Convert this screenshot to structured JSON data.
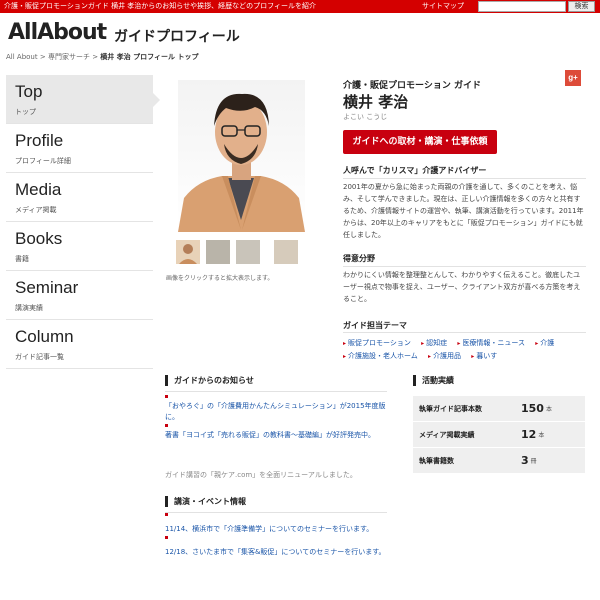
{
  "topbar": {
    "notice": "介護・販促プロモーションガイド 横井 孝治からのお知らせや挨拶、経歴などのプロフィールを紹介",
    "sitemap": "サイトマップ",
    "search_button": "検索"
  },
  "header": {
    "logo_text": "AllAbout",
    "title": "ガイドプロフィール"
  },
  "breadcrumb": {
    "items": [
      "All About",
      "専門家サーチ"
    ],
    "current": "横井 孝治 プロフィール トップ",
    "separator": ">"
  },
  "sidebar": {
    "items": [
      {
        "en": "Top",
        "jp": "トップ"
      },
      {
        "en": "Profile",
        "jp": "プロフィール詳細"
      },
      {
        "en": "Media",
        "jp": "メディア掲載"
      },
      {
        "en": "Books",
        "jp": "書籍"
      },
      {
        "en": "Seminar",
        "jp": "講演実績"
      },
      {
        "en": "Column",
        "jp": "ガイド記事一覧"
      }
    ]
  },
  "photo": {
    "caption": "画像をクリックすると拡大表示します。"
  },
  "profile": {
    "role": "介護・販促プロモーション ガイド",
    "name": "横井 孝治",
    "reading": "よこい こうじ",
    "request_button": "ガイドへの取材・講演・仕事依頼",
    "tagline": "人呼んで「カリスマ」介護アドバイザー",
    "intro": "2001年の夏から急に始まった両親の介護を通して、多くのことを考え、悩み、そして学んできました。現在は、正しい介護情報を多くの方々と共有するため、介護情報サイトの運営や、執筆、講演活動を行っています。2011年からは、20年以上のキャリアをもとに「販促プロモーション」ガイドにも就任しました。",
    "specialty_head": "得意分野",
    "specialty": "わかりにくい情報を整理整とんして、わかりやすく伝えること。徹底したユーザー視点で物事を捉え、ユーザー、クライアント双方が喜べる方策を考えること。",
    "themes_head": "ガイド担当テーマ",
    "themes": [
      "販促プロモーション",
      "認知症",
      "医療情報・ニュース",
      "介護",
      "介護施設・老人ホーム",
      "介護用品",
      "暮いす"
    ],
    "gplus": "g+"
  },
  "news": {
    "head": "ガイドからのお知らせ",
    "items": [
      "「おやろぐ」の「介護費用かんたんシミュレーション」が2015年度版に。",
      "著書「ヨコイ式「売れる販促」の教科書～基礎編」が好評発売中。"
    ],
    "cut": "ガイド講習の「親ケア.com」を全面リニューアルしました。"
  },
  "events": {
    "head": "講演・イベント情報",
    "items": [
      "11/14、横浜市で「介護準備学」についてのセミナーを行います。",
      "12/18、さいたま市で「集客&販促」についてのセミナーを行います。"
    ]
  },
  "stats": {
    "head": "活動実績",
    "rows": [
      {
        "label": "執筆ガイド記事本数",
        "num": "150",
        "unit": "本"
      },
      {
        "label": "メディア掲載実績",
        "num": "12",
        "unit": "本"
      },
      {
        "label": "執筆書籍数",
        "num": "3",
        "unit": "冊"
      }
    ]
  },
  "colors": {
    "brand_red": "#d40000",
    "button_red": "#c8000f",
    "link_blue": "#1a55a8"
  }
}
